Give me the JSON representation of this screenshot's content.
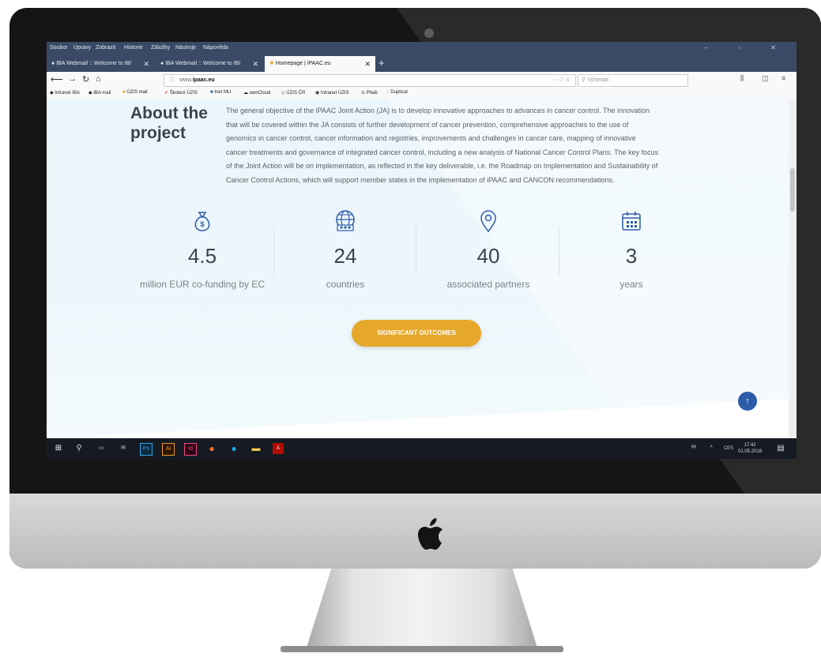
{
  "browser": {
    "menu": [
      "Soubor",
      "Úpravy",
      "Zobrazit",
      "Historie",
      "Záložky",
      "Nástroje",
      "Nápověda"
    ],
    "tabs": [
      {
        "label": "IBA Webmail :: Welcome to IB/",
        "active": false
      },
      {
        "label": "IBA Webmail :: Welcome to IB/",
        "active": false
      },
      {
        "label": "Homepage | iPAAC.eu",
        "active": true
      }
    ],
    "url_prefix": "www.",
    "url_domain": "ipaac.eu",
    "search_placeholder": "Vyhledat",
    "bookmarks": [
      "Intranet IBA",
      "IBA mail",
      "ÚZIS mail",
      "Školení ÚZIS",
      "Inet MU",
      "ownCloud",
      "ÚZIS ČR",
      "Intranet ÚZIS",
      "Phab",
      "Duplicat"
    ]
  },
  "page": {
    "heading_line1": "About the",
    "heading_line2": "project",
    "paragraph_lines": [
      "The general objective of the iPAAC Joint Action (JA) is to develop innovative approaches to advances in cancer control. The innovation",
      "that will be covered within the JA consists of further development of cancer prevention, comprehensive approaches to the use of",
      "genomics in cancer control, cancer information and registries, improvements and challenges in cancer care, mapping of innovative",
      "cancer treatments and governance of integrated cancer control, including a new analysis of National Cancer Control Plans. The key focus",
      "of the Joint Action will be on implementation, as reflected in the key deliverable, i.e. the Roadmap on Implementation and Sustainability of",
      "Cancer Control Actions, which will support member states in the implementation of iPAAC and CANCON recommendations."
    ],
    "stats": [
      {
        "value": "4.5",
        "label": "million EUR co-funding by EC",
        "icon": "money-bag-icon"
      },
      {
        "value": "24",
        "label": "countries",
        "icon": "globe-people-icon"
      },
      {
        "value": "40",
        "label": "associated partners",
        "icon": "map-pin-icon"
      },
      {
        "value": "3",
        "label": "years",
        "icon": "calendar-icon"
      }
    ],
    "cta_label": "SIGNIFICANT OUTCOMES",
    "to_top": "↑"
  },
  "taskbar": {
    "language": "CES",
    "time": "17:42",
    "date": "01.05.2018",
    "apps": [
      "start",
      "search",
      "task-view",
      "mail",
      "Ps",
      "Ai",
      "Id",
      "firefox",
      "skype",
      "explorer",
      "acrobat"
    ]
  },
  "colors": {
    "accent": "#e5a82a",
    "brand_blue": "#2d5ca8",
    "heading": "#3a4250",
    "firefox_chrome": "#3a4a66"
  }
}
